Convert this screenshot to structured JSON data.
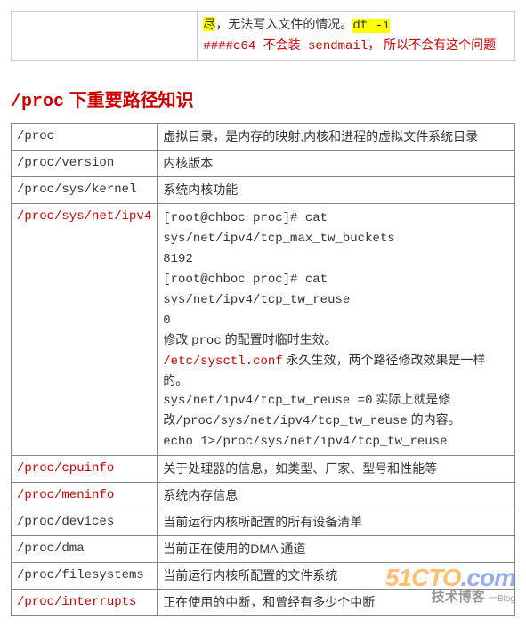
{
  "top_box": {
    "l1_pre": "尽",
    "l1_post": "，无法写入文件的情况。",
    "l1_code": "df -i",
    "l2_a": "####c64 不会装 sendmail，",
    "l2_b": "所以不会有这个问题"
  },
  "heading": {
    "code": "/proc",
    "rest": " 下重要路径知识"
  },
  "rows": [
    {
      "path": "/proc",
      "path_red": false
    },
    {
      "path": "/proc/version",
      "path_red": false
    },
    {
      "path": "/proc/sys/kernel",
      "path_red": false
    },
    {
      "path": "/proc/sys/net/ipv4",
      "path_red": true
    },
    {
      "path": "/proc/cpuinfo",
      "path_red": true
    },
    {
      "path": "/proc/meninfo",
      "path_red": true
    },
    {
      "path": "/proc/devices",
      "path_red": false
    },
    {
      "path": "/proc/dma",
      "path_red": false
    },
    {
      "path": "/proc/filesystems",
      "path_red": false
    },
    {
      "path": "/proc/interrupts",
      "path_red": true
    }
  ],
  "cells": {
    "r0": "虚拟目录，是内存的映射,内核和进程的虚拟文件系统目录",
    "r1": "内核版本",
    "r2": "系统内核功能",
    "r3_l1": "[root@chboc proc]# cat sys/net/ipv4/tcp_max_tw_buckets",
    "r3_l2": "8192",
    "r3_l3": "[root@chboc proc]# cat sys/net/ipv4/tcp_tw_reuse",
    "r3_l4": "0",
    "r3_l5_a": "修改 ",
    "r3_l5_b": "proc",
    "r3_l5_c": " 的配置时临时生效。",
    "r3_l6_a": "/etc/sysctl.conf",
    "r3_l6_b": " 永久生效，两个路径修改效果是一样的。",
    "r3_l7_a": "sys/net/ipv4/tcp_tw_reuse  =0",
    "r3_l7_b": " 实际上就是修改",
    "r3_l7_c": "/proc/sys/net/ipv4/tcp_tw_reuse",
    "r3_l7_d": " 的内容。",
    "r3_l8": "echo 1>/proc/sys/net/ipv4/tcp_tw_reuse",
    "r4": "关于处理器的信息，如类型、厂家、型号和性能等",
    "r5": "系统内存信息",
    "r6": "当前运行内核所配置的所有设备清单",
    "r7": "当前正在使用的DMA 通道",
    "r8": "当前运行内核所配置的文件系统",
    "r9": "正在使用的中断，和曾经有多少个中断"
  },
  "watermark": {
    "brand_a": "51CTO",
    "brand_b": ".com",
    "sub_a": "技术博客",
    "sub_b": "一Blog"
  }
}
